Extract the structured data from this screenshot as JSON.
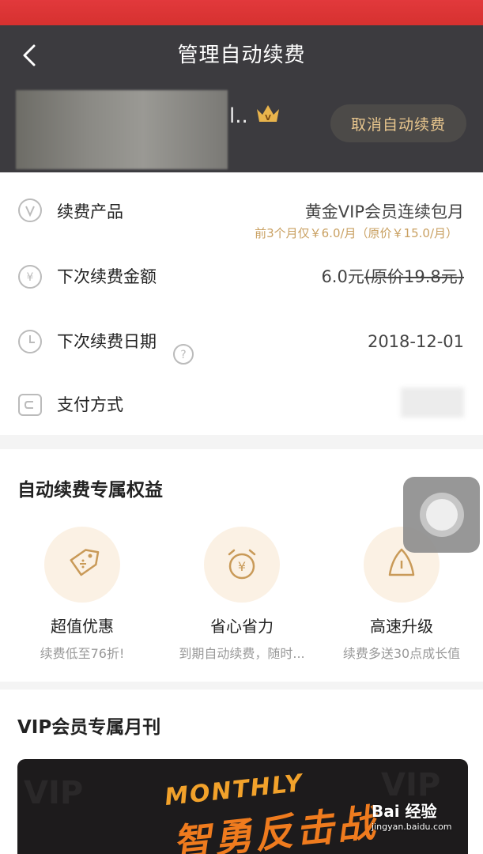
{
  "header": {
    "title": "管理自动续费",
    "user_name": "l..",
    "cancel_label": "取消自动续费"
  },
  "rows": {
    "product": {
      "label": "续费产品",
      "value": "黄金VIP会员连续包月",
      "sub": "前3个月仅￥6.0/月（原价￥15.0/月）"
    },
    "amount": {
      "label": "下次续费金额",
      "value": "6.0元",
      "original": "(原价19.8元)"
    },
    "date": {
      "label": "下次续费日期",
      "value": "2018-12-01"
    },
    "payment": {
      "label": "支付方式"
    }
  },
  "benefits": {
    "title": "自动续费专属权益",
    "items": [
      {
        "title": "超值优惠",
        "desc": "续费低至76折!"
      },
      {
        "title": "省心省力",
        "desc": "到期自动续费，随时..."
      },
      {
        "title": "高速升级",
        "desc": "续费多送30点成长值"
      }
    ]
  },
  "monthly": {
    "title": "VIP会员专属月刊",
    "banner_line1": "MONTHLY",
    "banner_line2": "智勇反击战"
  },
  "watermark": {
    "main": "Bai 经验",
    "sub": "jingyan.baidu.com"
  },
  "colors": {
    "header_bg": "#3c3b3f",
    "accent_gold": "#c9a061",
    "status_red": "#d6312f"
  }
}
